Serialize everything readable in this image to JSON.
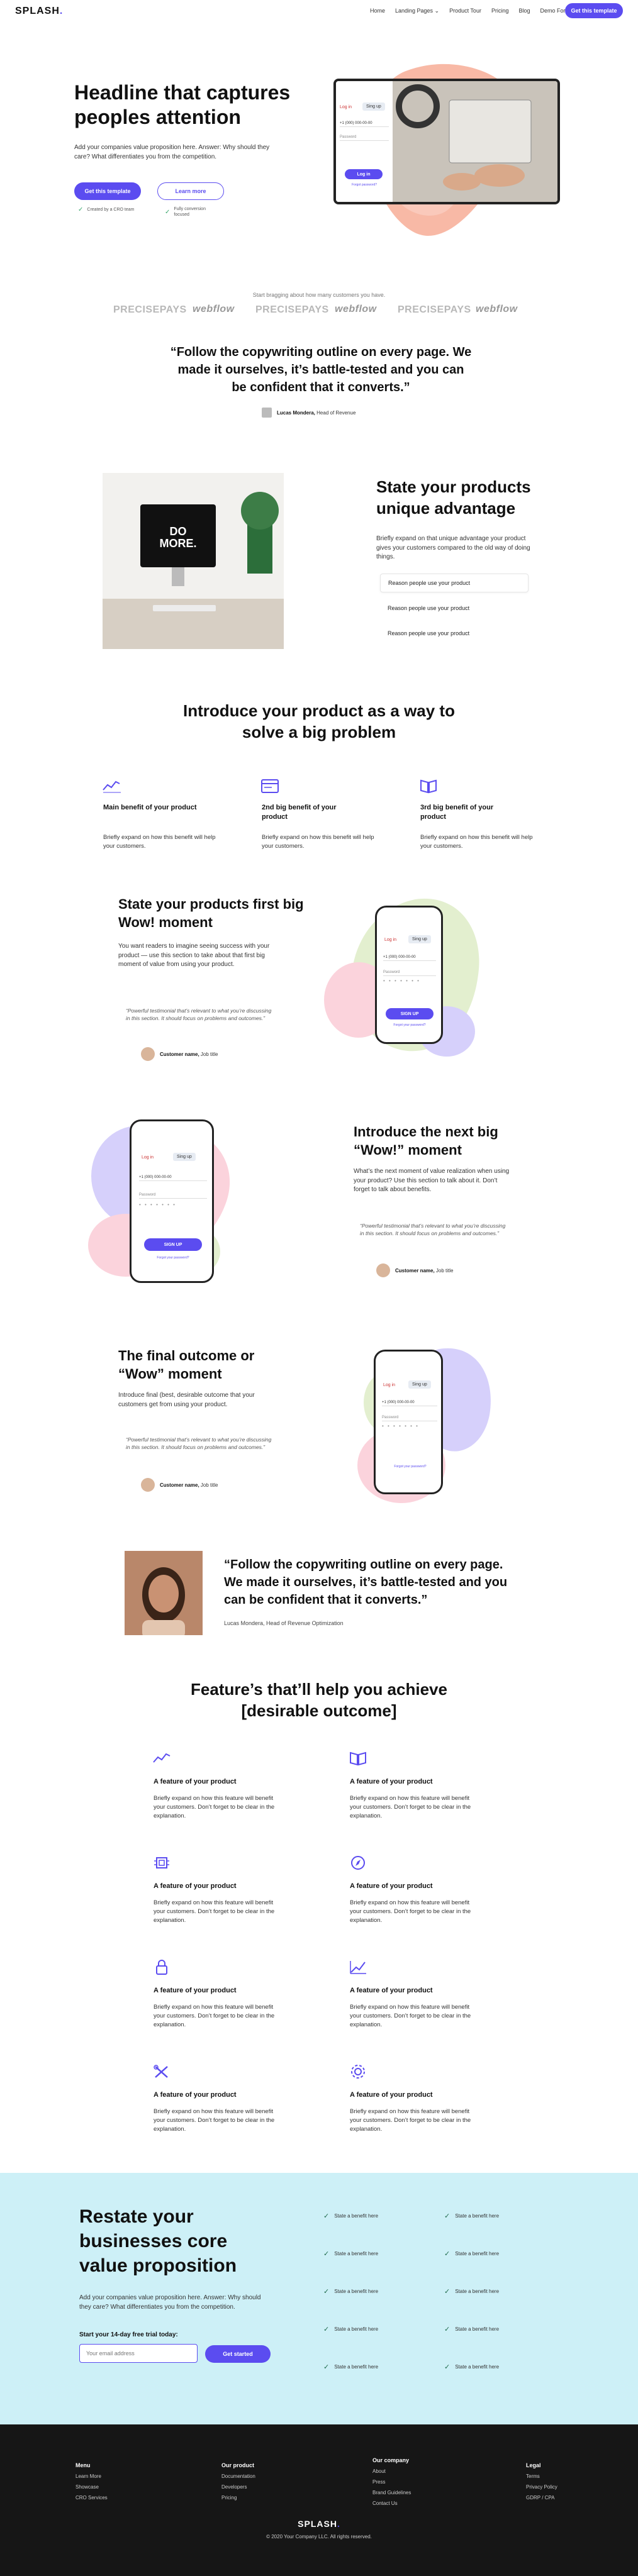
{
  "nav": {
    "logo": "SPLASH",
    "links": [
      "Home",
      "Landing Pages ⌄",
      "Product Tour",
      "Pricing",
      "Blog",
      "Demo Form"
    ],
    "cta": "Get this template"
  },
  "hero": {
    "title": "Headline that captures peoples attention",
    "subtitle": "Add your companies value proposition here. Answer: Why should they care? What differentiates you from the competition.",
    "primary_btn": "Get this template",
    "secondary_btn": "Learn more",
    "checks": [
      "Created by a CRO team",
      "Fully conversion focused"
    ],
    "mock": {
      "tab_login": "Log in",
      "tab_signup": "Sing up",
      "phone_value": "+1 (000) 000-00-00",
      "password_label": "Password",
      "btn": "Log in",
      "forgot": "Forgot password?"
    }
  },
  "logos": {
    "caption": "Start bragging about how many customers you have.",
    "brands": [
      "PRECISEPAYS",
      "webflow",
      "PRECISEPAYS",
      "webflow",
      "PRECISEPAYS",
      "webflow"
    ]
  },
  "quote1": {
    "text": "“Follow the copywriting outline on every page. We made it ourselves, it’s battle-tested and you can be confident that it converts.”",
    "author": "Lucas Mondera,",
    "role": "Head of Revenue"
  },
  "advantage": {
    "title": "State your products unique advantage",
    "body": "Briefly expand on that unique advantage your product gives your customers compared to the old way of doing things.",
    "image_text": "DO MORE.",
    "reasons": [
      "Reason people use your product",
      "Reason people use your product",
      "Reason people use your product"
    ]
  },
  "intro": {
    "title": "Introduce your product as a way to solve a big problem",
    "benefits": [
      {
        "title": "Main benefit of your product",
        "body": "Briefly expand on how this benefit will help your customers."
      },
      {
        "title": "2nd big benefit of your product",
        "body": "Briefly expand on how this benefit will help your customers."
      },
      {
        "title": "3rd big benefit of your product",
        "body": "Briefly expand on how this benefit will help your customers."
      }
    ]
  },
  "wow1": {
    "title": "State your products first big Wow! moment",
    "body": "You want readers to imagine seeing success with your product — use this section to take about that first big moment of value from using your product.",
    "testimonial": "“Powerful testimonial that’s relevant to what you’re discussing in this section. It should focus on problems and outcomes.”",
    "customer": "Customer name,",
    "customer_role": "Job title",
    "mock": {
      "tab_login": "Log in",
      "tab_signup": "Sing up",
      "phone_value": "+1 (000) 000-00-00",
      "password_label": "Password",
      "btn": "SIGN UP",
      "forgot": "Forgot your password?"
    }
  },
  "wow2": {
    "title": "Introduce the next big “Wow!” moment",
    "body": "What’s the next moment of value realization when using your product? Use this section to talk about it. Don’t forget to talk about benefits.",
    "testimonial": "“Powerful testimonial that’s relevant to what you’re discussing in this section. It should focus on problems and outcomes.”",
    "customer": "Customer name,",
    "customer_role": "Job title",
    "mock": {
      "tab_login": "Log in",
      "tab_signup": "Sing up",
      "phone_value": "+1 (000) 000-00-00",
      "password_label": "Password",
      "btn": "SIGN UP",
      "forgot": "Forgot your password?"
    }
  },
  "wow3": {
    "title": "The final outcome or “Wow” moment",
    "body": "Introduce final (best, desirable outcome that your customers get from using your product.",
    "testimonial": "“Powerful testimonial that’s relevant to what you’re discussing in this section. It should focus on problems and outcomes.”",
    "customer": "Customer name,",
    "customer_role": "Job title",
    "mock": {
      "tab_login": "Log in",
      "tab_signup": "Sing up",
      "phone_value": "+1 (000) 000-00-00",
      "password_label": "Password",
      "forgot": "Forgot your password?"
    }
  },
  "quote2": {
    "text": "“Follow the copywriting outline on every page. We made it ourselves, it’s battle-tested and you can be confident that it converts.”",
    "author": "Lucas Mondera, Head of Revenue Optimization"
  },
  "features": {
    "title": "Feature’s that’ll help you achieve [desirable outcome]",
    "items": [
      {
        "icon": "trend-icon",
        "title": "A feature of your product",
        "body": "Briefly expand on how this feature will benefit your customers. Don’t forget to be clear in the explanation."
      },
      {
        "icon": "book-icon",
        "title": "A feature of your product",
        "body": "Briefly expand on how this feature will benefit your customers. Don’t forget to be clear in the explanation."
      },
      {
        "icon": "chip-icon",
        "title": "A feature of your product",
        "body": "Briefly expand on how this feature will benefit your customers. Don’t forget to be clear in the explanation."
      },
      {
        "icon": "compass-icon",
        "title": "A feature of your product",
        "body": "Briefly expand on how this feature will benefit your customers. Don’t forget to be clear in the explanation."
      },
      {
        "icon": "lock-icon",
        "title": "A feature of your product",
        "body": "Briefly expand on how this feature will benefit your customers. Don’t forget to be clear in the explanation."
      },
      {
        "icon": "chart-icon",
        "title": "A feature of your product",
        "body": "Briefly expand on how this feature will benefit your customers. Don’t forget to be clear in the explanation."
      },
      {
        "icon": "tools-icon",
        "title": "A feature of your product",
        "body": "Briefly expand on how this feature will benefit your customers. Don’t forget to be clear in the explanation."
      },
      {
        "icon": "gear-icon",
        "title": "A feature of your product",
        "body": "Briefly expand on how this feature will benefit your customers. Don’t forget to be clear in the explanation."
      }
    ]
  },
  "cta": {
    "title": "Restate your businesses core value proposition",
    "body": "Add your companies value proposition here. Answer: Why should they care? What differentiates you from the competition.",
    "trial": "Start your 14-day free trial today:",
    "email_placeholder": "Your email address",
    "btn": "Get started",
    "benefits": [
      "State a benefit here",
      "State a benefit here",
      "State a benefit here",
      "State a benefit here",
      "State a benefit here",
      "State a benefit here",
      "State a benefit here",
      "State a benefit here",
      "State a benefit here",
      "State a benefit here"
    ]
  },
  "footer": {
    "cols": [
      {
        "title": "Menu",
        "links": [
          "Learn More",
          "Showcase",
          "CRO Services"
        ]
      },
      {
        "title": "Our product",
        "links": [
          "Documentation",
          "Developers",
          "Pricing"
        ]
      },
      {
        "title": "Our company",
        "links": [
          "About",
          "Press",
          "Brand Guidelines",
          "Contact Us"
        ]
      },
      {
        "title": "Legal",
        "links": [
          "Terms",
          "Privacy Policy",
          "GDRP / CPA"
        ]
      }
    ],
    "logo": "SPLASH",
    "copyright": "© 2020 Your Company LLC. All rights reserved."
  },
  "colors": {
    "accent": "#5b4cf0",
    "cta_bg": "#cdf0f7",
    "footer_bg": "#161616"
  }
}
